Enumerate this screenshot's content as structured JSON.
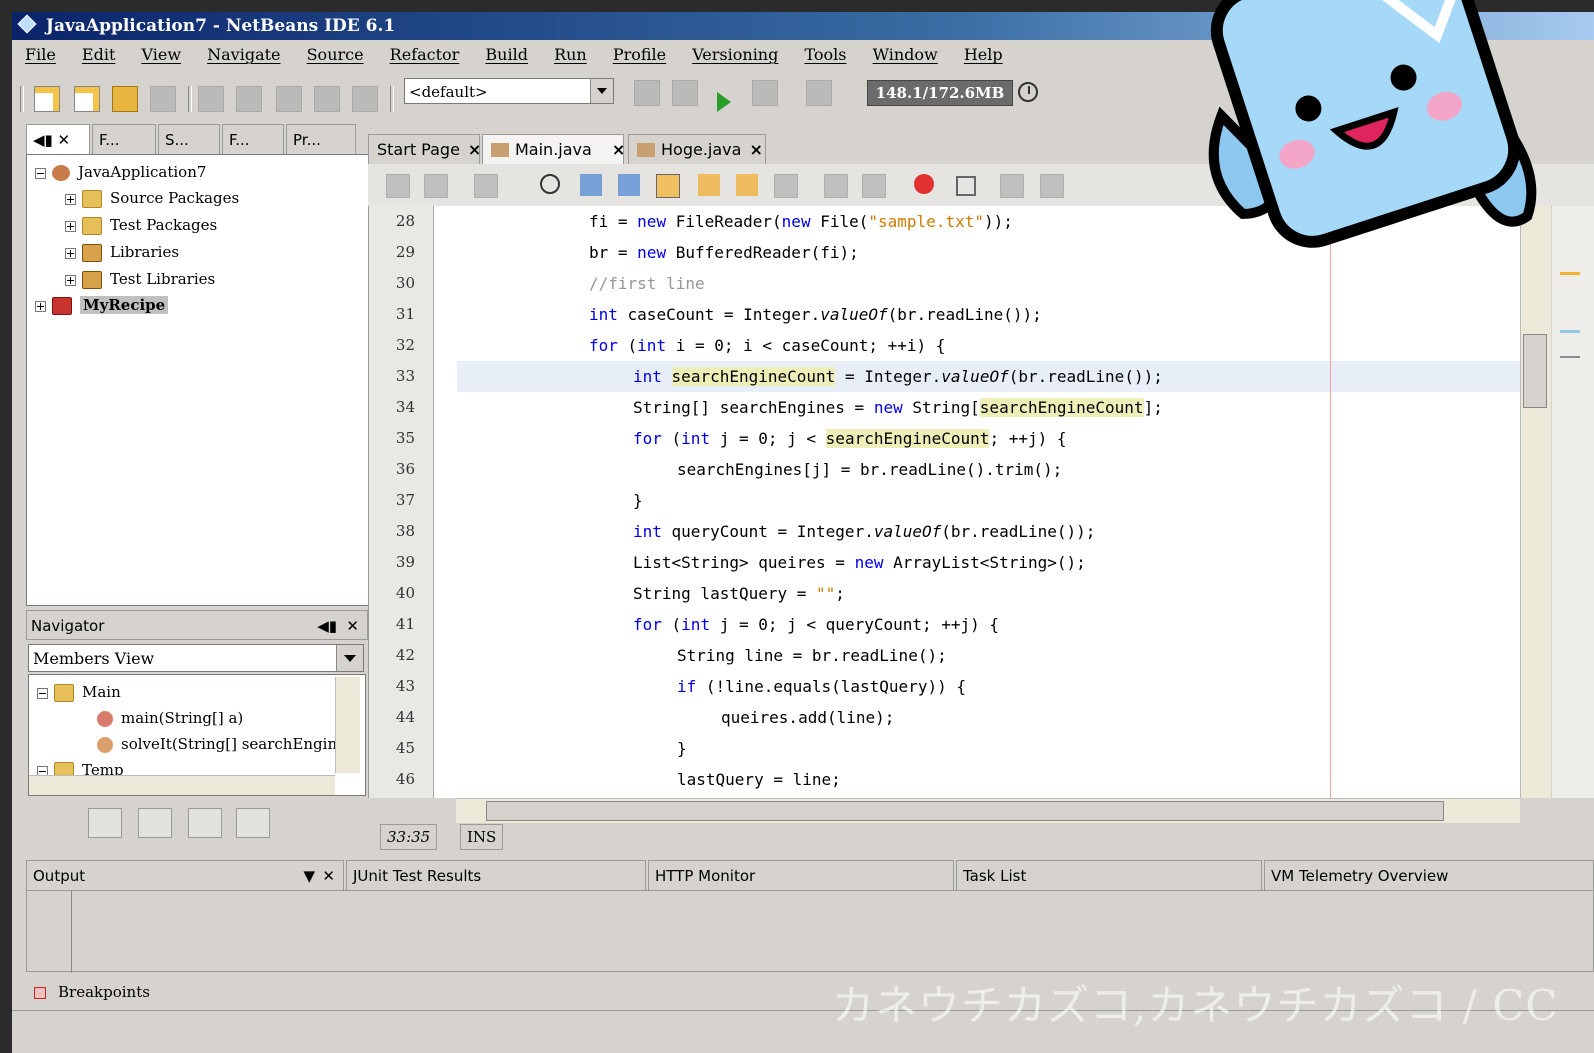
{
  "window": {
    "title": "JavaApplication7 - NetBeans IDE 6.1"
  },
  "menu": [
    "File",
    "Edit",
    "View",
    "Navigate",
    "Source",
    "Refactor",
    "Build",
    "Run",
    "Profile",
    "Versioning",
    "Tools",
    "Window",
    "Help"
  ],
  "toolbar": {
    "config_value": "<default>",
    "memory": "148.1/172.6MB"
  },
  "project_tabs": [
    "◀▮ ✕",
    "F...",
    "S...",
    "F...",
    "Pr..."
  ],
  "project_tree": {
    "root": "JavaApplication7",
    "children": [
      "Source Packages",
      "Test Packages",
      "Libraries",
      "Test Libraries"
    ],
    "other": "MyRecipe"
  },
  "navigator": {
    "title": "Navigator",
    "view": "Members View",
    "items": [
      "Main",
      "main(String[] a)",
      "solveIt(String[] searchEngin",
      "Temp"
    ]
  },
  "editor_tabs": [
    {
      "label": "Start Page",
      "close": "×"
    },
    {
      "label": "Main.java",
      "close": "×"
    },
    {
      "label": "Hoge.java",
      "close": "×"
    }
  ],
  "code_lines": [
    {
      "num": "28",
      "text": "fi = new FileReader(new File(\"sample.txt\"));"
    },
    {
      "num": "29",
      "text": "br = new BufferedReader(fi);"
    },
    {
      "num": "30",
      "text": "//first line"
    },
    {
      "num": "31",
      "text": "int caseCount = Integer.valueOf(br.readLine());"
    },
    {
      "num": "32",
      "text": "for (int i = 0; i < caseCount; ++i) {"
    },
    {
      "num": "33",
      "text": "int searchEngineCount = Integer.valueOf(br.readLine());"
    },
    {
      "num": "34",
      "text": "String[] searchEngines = new String[searchEngineCount];"
    },
    {
      "num": "35",
      "text": "for (int j = 0; j < searchEngineCount; ++j) {"
    },
    {
      "num": "36",
      "text": "searchEngines[j] = br.readLine().trim();"
    },
    {
      "num": "37",
      "text": "}"
    },
    {
      "num": "38",
      "text": "int queryCount = Integer.valueOf(br.readLine());"
    },
    {
      "num": "39",
      "text": "List<String> queires = new ArrayList<String>();"
    },
    {
      "num": "40",
      "text": "String lastQuery = \"\";"
    },
    {
      "num": "41",
      "text": "for (int j = 0; j < queryCount; ++j) {"
    },
    {
      "num": "42",
      "text": "String line = br.readLine();"
    },
    {
      "num": "43",
      "text": "if (!line.equals(lastQuery)) {"
    },
    {
      "num": "44",
      "text": "queires.add(line);"
    },
    {
      "num": "45",
      "text": "}"
    },
    {
      "num": "46",
      "text": "lastQuery = line;"
    }
  ],
  "status": {
    "position": "33:35",
    "mode": "INS"
  },
  "bottom_tabs": [
    "Output",
    "JUnit Test Results",
    "HTTP Monitor",
    "Task List",
    "VM Telemetry Overview"
  ],
  "breakpoints": "Breakpoints",
  "watermark": "カネウチカズコ,カネウチカズコ / CC",
  "colors": {
    "keyword": "#0000e6",
    "string": "#ce7b00",
    "comment": "#969696",
    "occurrence": "#eeeeb8",
    "current_line": "#e8eef7"
  }
}
